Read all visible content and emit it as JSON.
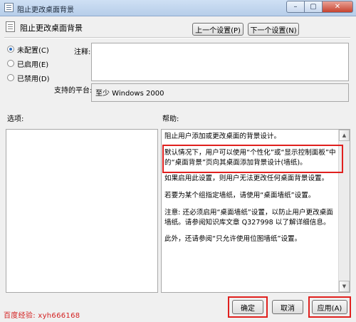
{
  "window": {
    "title": "阻止更改桌面背景",
    "min_glyph": "–",
    "max_glyph": "▢",
    "close_glyph": "✕"
  },
  "header": {
    "setting_title": "阻止更改桌面背景",
    "prev_button": "上一个设置(P)",
    "next_button": "下一个设置(N)"
  },
  "state": {
    "options": [
      "未配置(C)",
      "已启用(E)",
      "已禁用(D)"
    ],
    "selected_index": 0
  },
  "comment": {
    "label": "注释:",
    "value": ""
  },
  "platform": {
    "label": "支持的平台:",
    "value": "至少 Windows 2000"
  },
  "panels": {
    "options_label": "选项:",
    "help_label": "帮助:"
  },
  "help": {
    "paragraphs": [
      "阻止用户添加或更改桌面的背景设计。",
      "默认情况下，用户可以使用“个性化”或“显示控制面板”中的“桌面背景”页向其桌面添加背景设计(墙纸)。",
      "如果启用此设置，则用户无法更改任何桌面背景设置。",
      "若要为某个组指定墙纸，请使用“桌面墙纸”设置。",
      "注意: 还必须启用“桌面墙纸”设置，以防止用户更改桌面墙纸。请参阅知识库文章 Q327998 以了解详细信息。",
      "此外，还请参阅“只允许使用位图墙纸”设置。"
    ]
  },
  "footer": {
    "ok": "确定",
    "cancel": "取消",
    "apply": "应用(A)"
  },
  "watermark": "百度经验: xyh666168",
  "colors": {
    "highlight_border": "#e0201e",
    "watermark_text": "#d32020"
  }
}
